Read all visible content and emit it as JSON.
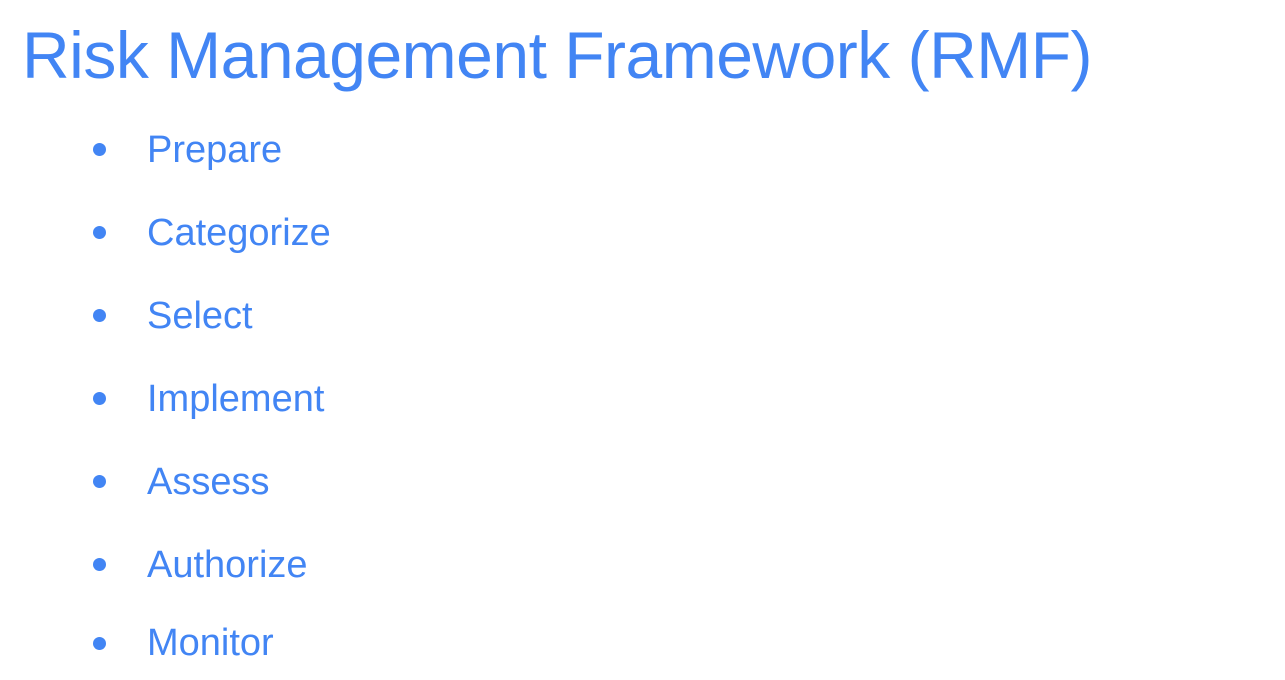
{
  "slide": {
    "title": "Risk Management Framework (RMF)",
    "items": [
      {
        "label": "Prepare"
      },
      {
        "label": "Categorize"
      },
      {
        "label": "Select"
      },
      {
        "label": "Implement"
      },
      {
        "label": "Assess"
      },
      {
        "label": "Authorize"
      },
      {
        "label": "Monitor"
      }
    ]
  },
  "colors": {
    "text": "#4285f4",
    "bullet": "#4285f4",
    "background": "#ffffff"
  }
}
